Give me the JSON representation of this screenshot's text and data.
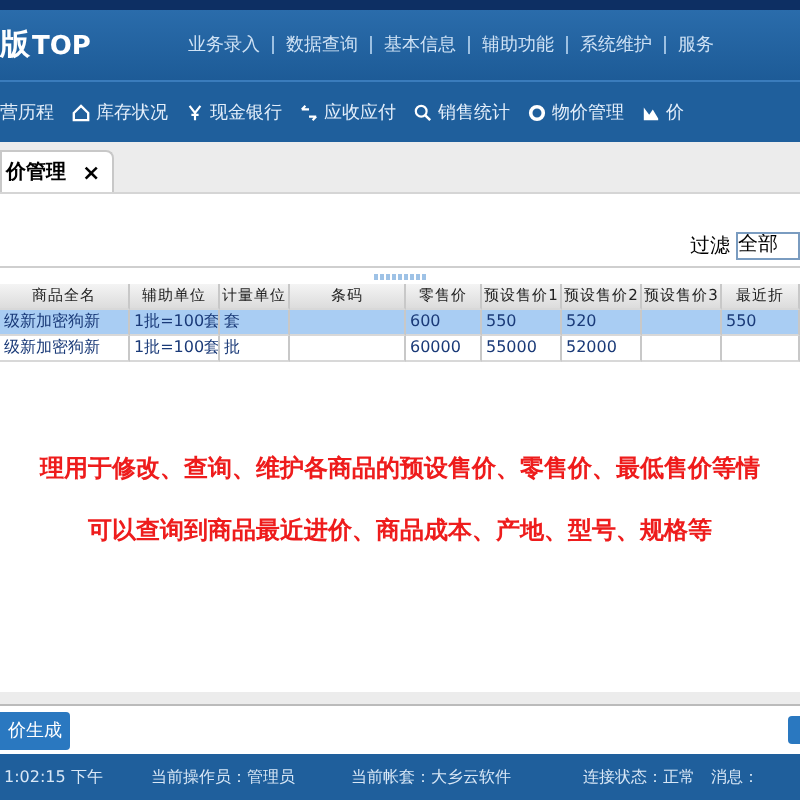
{
  "logo": {
    "mark": "版",
    "text": "TOP"
  },
  "top_menu": [
    "业务录入",
    "数据查询",
    "基本信息",
    "辅助功能",
    "系统维护",
    "服务"
  ],
  "nav": [
    {
      "label": "营历程",
      "kind": "plain"
    },
    {
      "label": "库存状况",
      "kind": "house"
    },
    {
      "label": "现金银行",
      "kind": "yen"
    },
    {
      "label": "应收应付",
      "kind": "arrows"
    },
    {
      "label": "销售统计",
      "kind": "search"
    },
    {
      "label": "物价管理",
      "kind": "gear"
    },
    {
      "label": "价",
      "kind": "chart"
    }
  ],
  "tabs": [
    {
      "label": "价管理",
      "close": "×",
      "selected": true
    }
  ],
  "filter": {
    "label": "过滤",
    "value": "全部"
  },
  "table": {
    "columns": [
      "商品全名",
      "辅助单位",
      "计量单位",
      "条码",
      "零售价",
      "预设售价1",
      "预设售价2",
      "预设售价3",
      "最近折"
    ],
    "rows": [
      {
        "selected": true,
        "cells": [
          "级新加密狗新",
          "1批=100套",
          "套",
          "",
          "600",
          "550",
          "520",
          "",
          "550"
        ]
      },
      {
        "selected": false,
        "cells": [
          "级新加密狗新",
          "1批=100套",
          "批",
          "",
          "60000",
          "55000",
          "52000",
          "",
          ""
        ]
      }
    ]
  },
  "notes": [
    "理用于修改、查询、维护各商品的预设售价、零售价、最低售价等情",
    "可以查询到商品最近进价、商品成本、产地、型号、规格等"
  ],
  "generate_button": "价生成",
  "status_bar": [
    "1:02:15 下午",
    "当前操作员：管理员",
    "当前帐套：大乡云软件",
    "连接状态：正常",
    "消息："
  ]
}
